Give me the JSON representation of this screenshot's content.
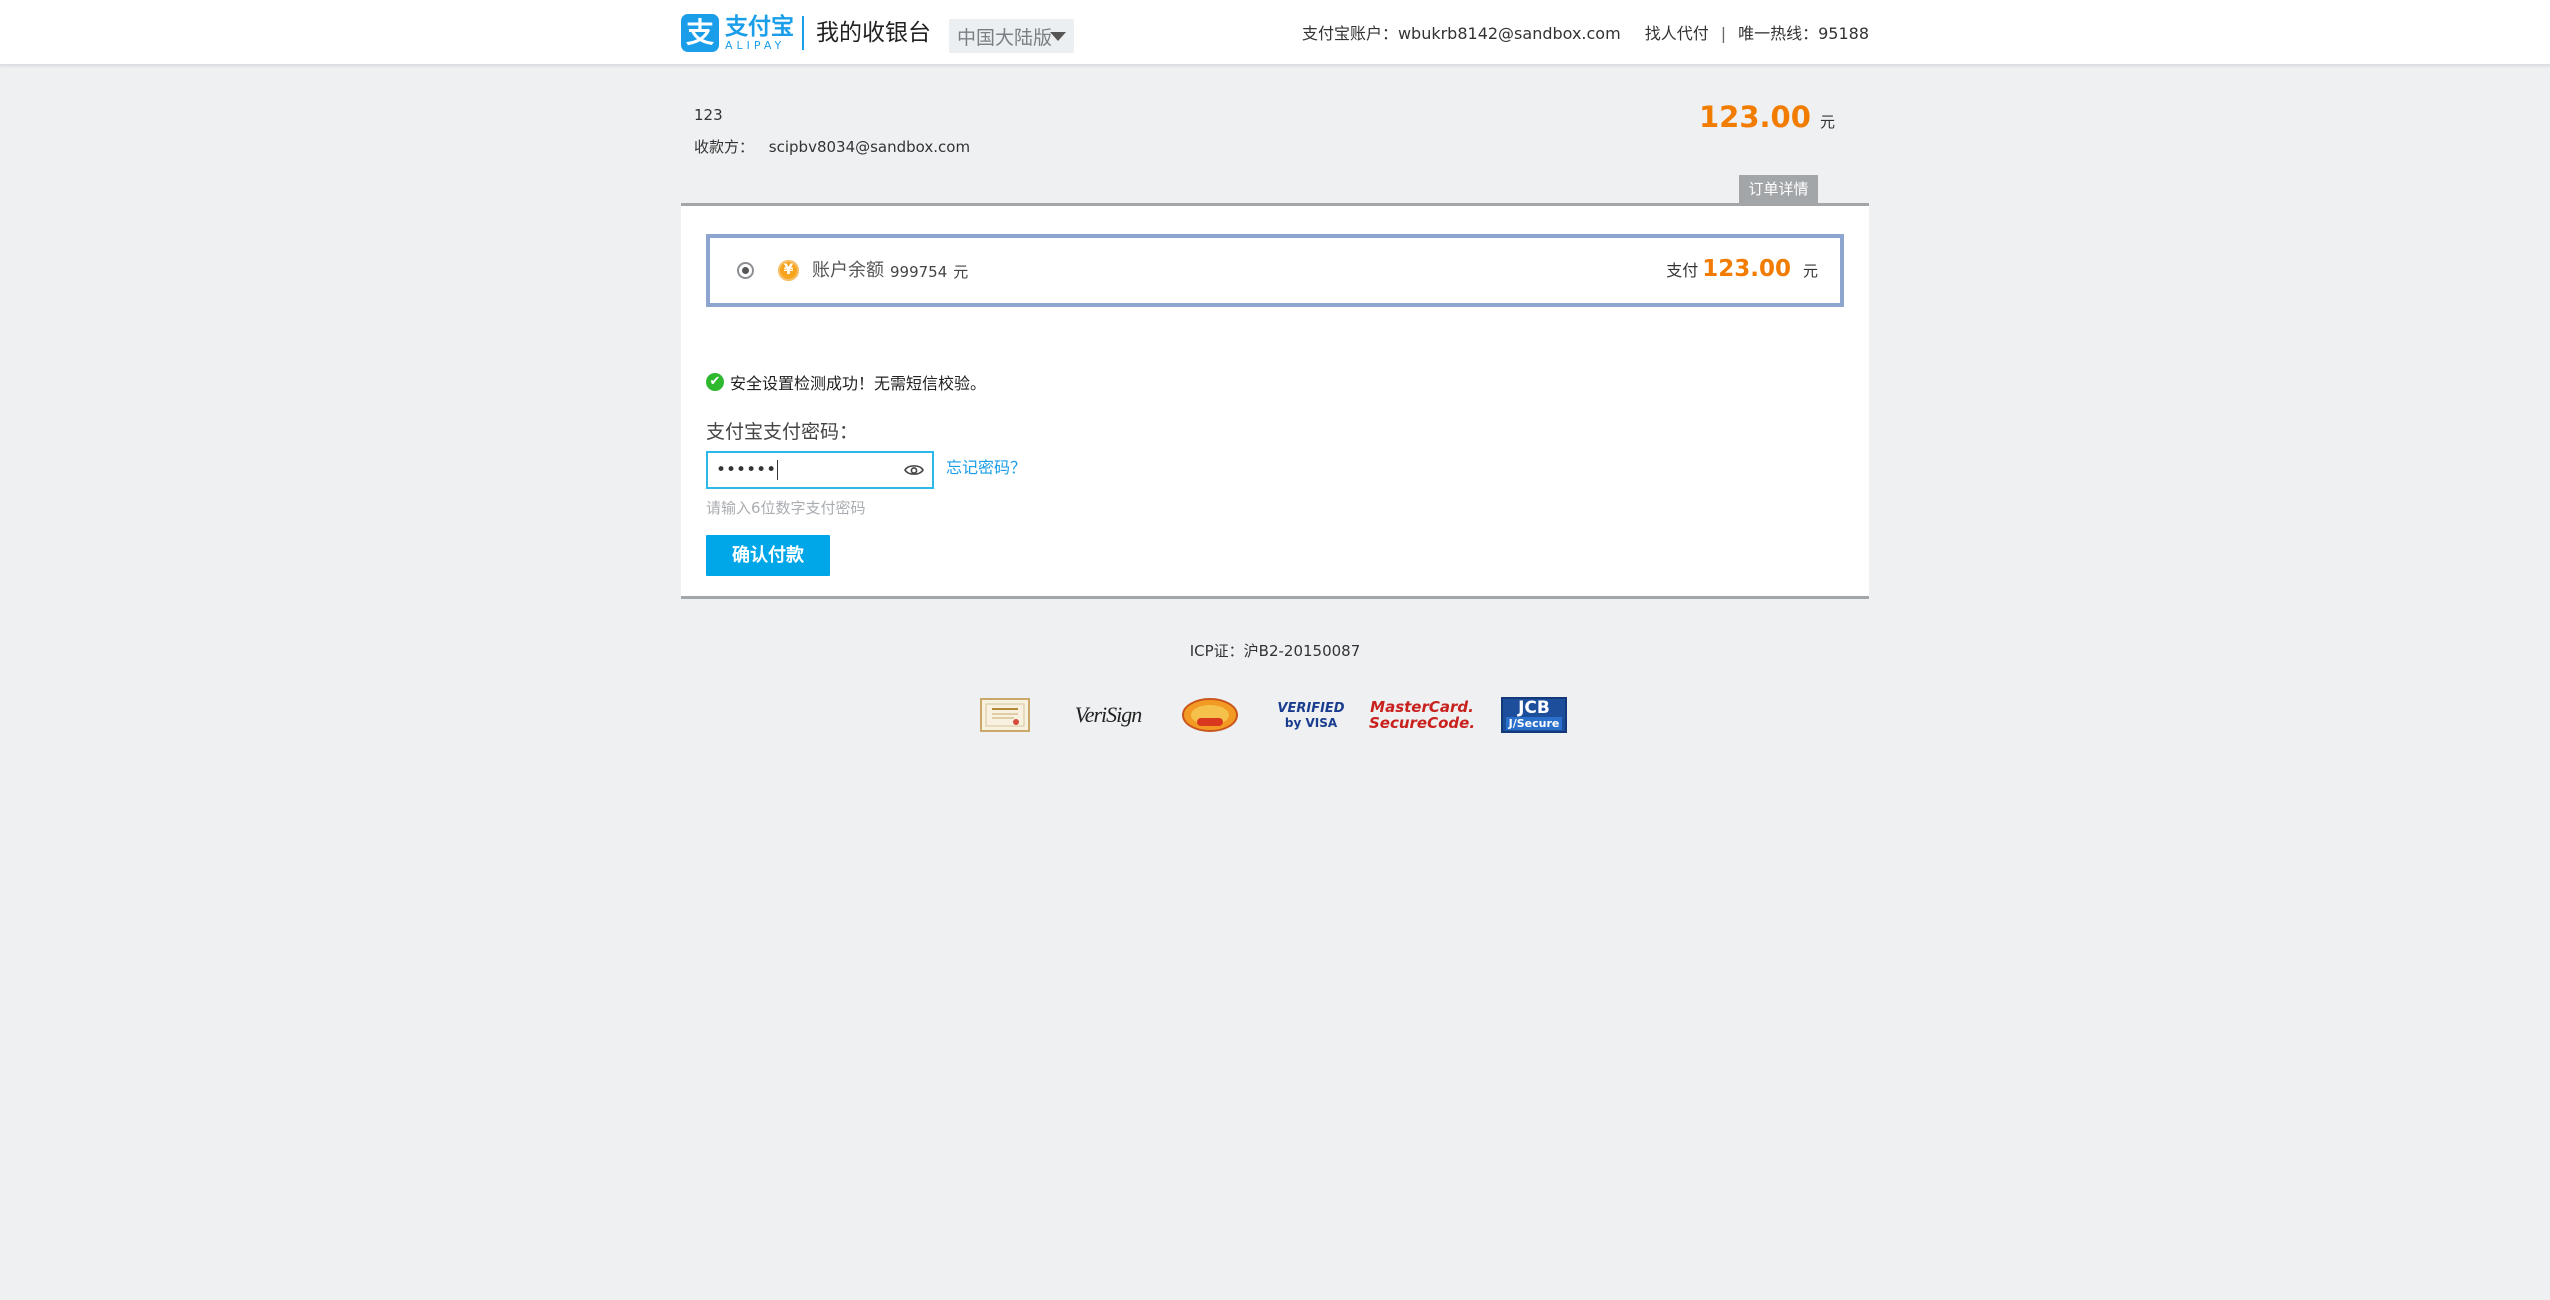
{
  "header": {
    "logo_mark": "支",
    "logo_cn": "支付宝",
    "logo_en": "ALIPAY",
    "cashier_title": "我的收银台",
    "region": "中国大陆版",
    "account_label": "支付宝账户：wbukrb8142@sandbox.com",
    "pay_for_others": "找人代付",
    "separator": "|",
    "hotline": "唯一热线：95188"
  },
  "order": {
    "name": "123",
    "payee_label": "收款方：",
    "payee": "scipbv8034@sandbox.com",
    "amount": "123.00",
    "amount_unit": "元",
    "detail_tab": "订单详情"
  },
  "payment": {
    "balance_icon": "¥",
    "balance_label": "账户余额",
    "balance_value": "999754",
    "balance_unit": "元",
    "pay_label": "支付",
    "pay_amount": "123.00",
    "pay_unit": "元",
    "security_check_icon": "✔",
    "security_text": "安全设置检测成功！无需短信校验。",
    "password_label": "支付宝支付密码：",
    "password_value": "••••••",
    "forgot_password": "忘记密码？",
    "password_hint": "请输入6位数字支付密码",
    "confirm_button": "确认付款"
  },
  "footer": {
    "icp": "ICP证：沪B2-20150087",
    "certs": [
      {
        "name": "verisign-text",
        "text": "VeriSign"
      },
      {
        "name": "visa-verified",
        "line1": "VERIFIED",
        "line2": "by VISA"
      },
      {
        "name": "mastercard",
        "line1": "MasterCard.",
        "line2": "SecureCode."
      },
      {
        "name": "jcb",
        "line1": "JCB",
        "line2": "J/Secure"
      }
    ]
  },
  "colors": {
    "accent_blue": "#1a9ee9",
    "amount_orange": "#f27c00",
    "button_blue": "#00a7e8",
    "success_green": "#2eb82e"
  }
}
